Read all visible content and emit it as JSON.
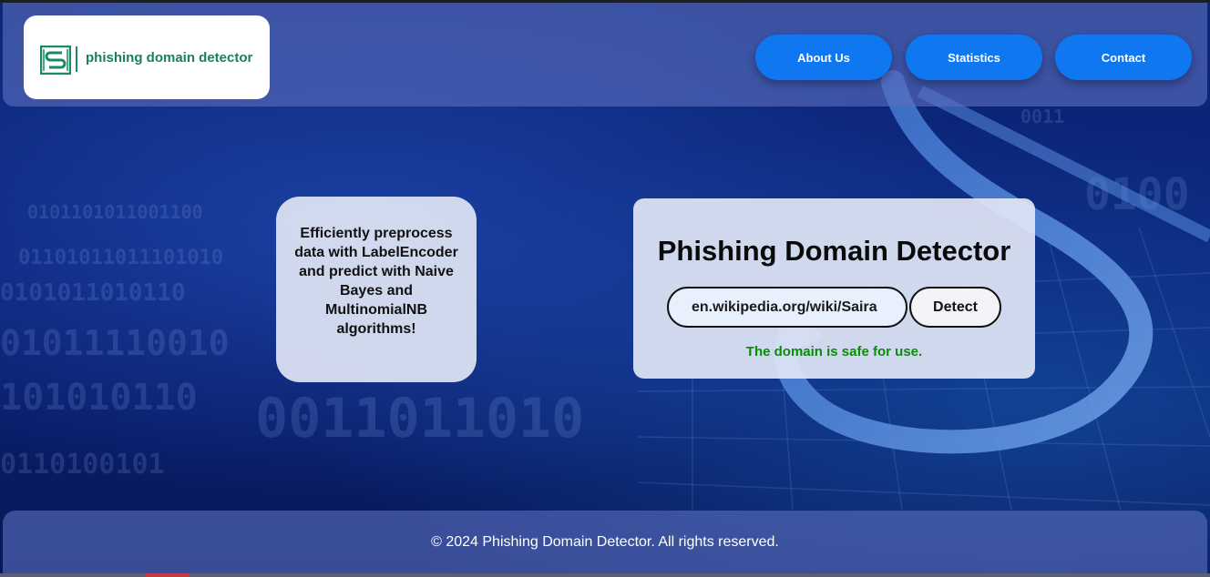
{
  "colors": {
    "nav_button": "#0f78f0",
    "logo_green": "#1a7f5f",
    "result_green": "#0b8a0b"
  },
  "header": {
    "logo_icon": "logo-mark-icon",
    "logo_text": "phishing domain detector",
    "nav": [
      {
        "label": "About Us"
      },
      {
        "label": "Statistics"
      },
      {
        "label": "Contact"
      }
    ]
  },
  "info_card": {
    "text": "Efficiently preprocess data with LabelEncoder and predict with Naive Bayes and MultinomialNB algorithms!"
  },
  "detector": {
    "title": "Phishing Domain Detector",
    "input_value": "en.wikipedia.org/wiki/Saira",
    "detect_label": "Detect",
    "result": "The domain is safe for use."
  },
  "footer": {
    "text": "© 2024 Phishing Domain Detector. All rights reserved."
  }
}
